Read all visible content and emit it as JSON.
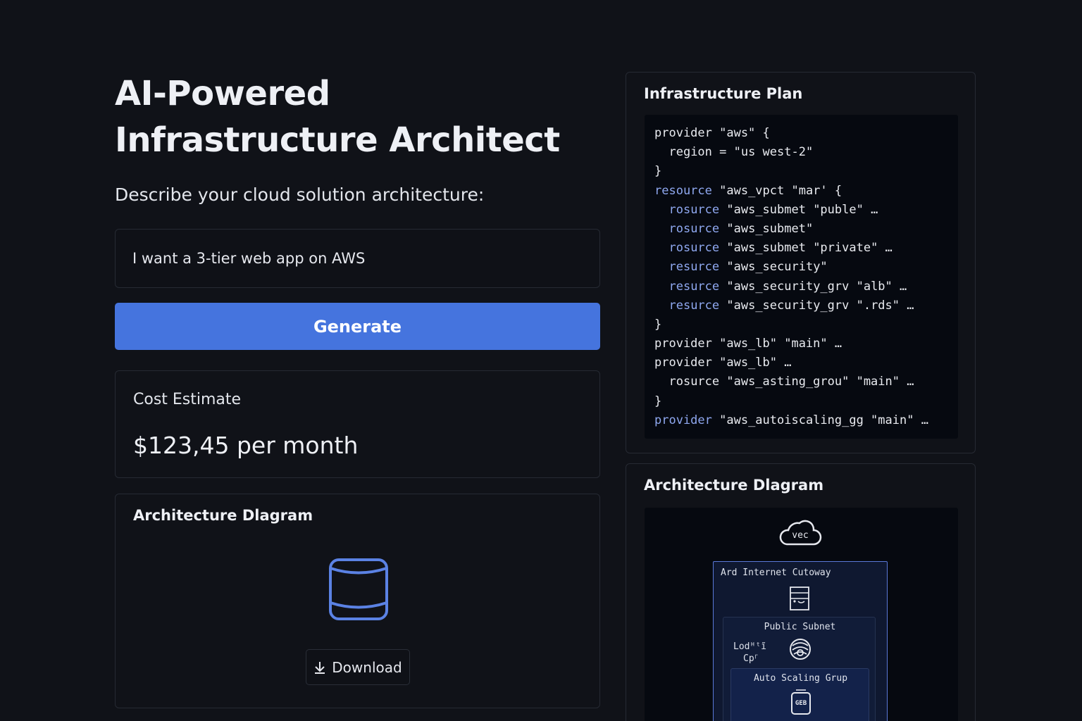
{
  "header": {
    "title": "AI-Powered Infrastructure Architect",
    "prompt_label": "Describe your cloud solution architecture:"
  },
  "input": {
    "value": "I want a 3-tier web app on AWS"
  },
  "generate_button": {
    "label": "Generate"
  },
  "cost": {
    "title": "Cost Estimate",
    "value": "$123,45 per month"
  },
  "diagram_card": {
    "title": "Architecture Dlagram",
    "download_label": "Download",
    "icon": "database-icon"
  },
  "plan": {
    "title": "Infrastructure Plan",
    "lines": [
      {
        "kw": "",
        "indent": "",
        "text": "provider \"aws\" {"
      },
      {
        "kw": "",
        "indent": "  ",
        "text": "region = \"us west-2\""
      },
      {
        "kw": "",
        "indent": "",
        "text": "}"
      },
      {
        "kw": "resource",
        "indent": "",
        "text": " \"aws_vpct \"mar' {"
      },
      {
        "kw": "rosurce",
        "indent": "  ",
        "text": " \"aws_submet \"puble\" …"
      },
      {
        "kw": "rosurce",
        "indent": "  ",
        "text": " \"aws_submet\""
      },
      {
        "kw": "rosurce",
        "indent": "  ",
        "text": " \"aws_submet \"private\" …"
      },
      {
        "kw": "resurce",
        "indent": "  ",
        "text": " \"aws_security\""
      },
      {
        "kw": "resurce",
        "indent": "  ",
        "text": " \"aws_security_grv \"alb\" …"
      },
      {
        "kw": "resurce",
        "indent": "  ",
        "text": " \"aws_security_grv \".rds\" …"
      },
      {
        "kw": "",
        "indent": "",
        "text": "}"
      },
      {
        "kw": "",
        "indent": "",
        "text": "provider \"aws_lb\" \"main\" …"
      },
      {
        "kw": "",
        "indent": "",
        "text": "provider \"aws_lb\" …"
      },
      {
        "kw": "",
        "indent": "  ",
        "text": "rosurce \"aws_asting_grou\" \"main\" …"
      },
      {
        "kw": "",
        "indent": "",
        "text": "}"
      },
      {
        "kw": "provider",
        "indent": "",
        "text": " \"aws_autoiscaling_gg \"main\" …"
      }
    ],
    "keyword_color": "#8fa8f0"
  },
  "arch": {
    "title": "Architecture Dlagram",
    "cloud_label": "vec",
    "vpc_label": "Ard  Internet Cutoway",
    "public_label": "Public Subnet",
    "lb_label_1": "Lodᴴᵗĩ",
    "lb_label_2": "Cp⸀",
    "asg_label": "Auto Scaling Grup",
    "ec2_label": "GEB",
    "icons": [
      "cloud-icon",
      "internet-gateway-icon",
      "load-balancer-icon",
      "ec2-icon"
    ]
  },
  "colors": {
    "background": "#101218",
    "accent": "#4574de",
    "vpc_border": "#5a78d8"
  }
}
